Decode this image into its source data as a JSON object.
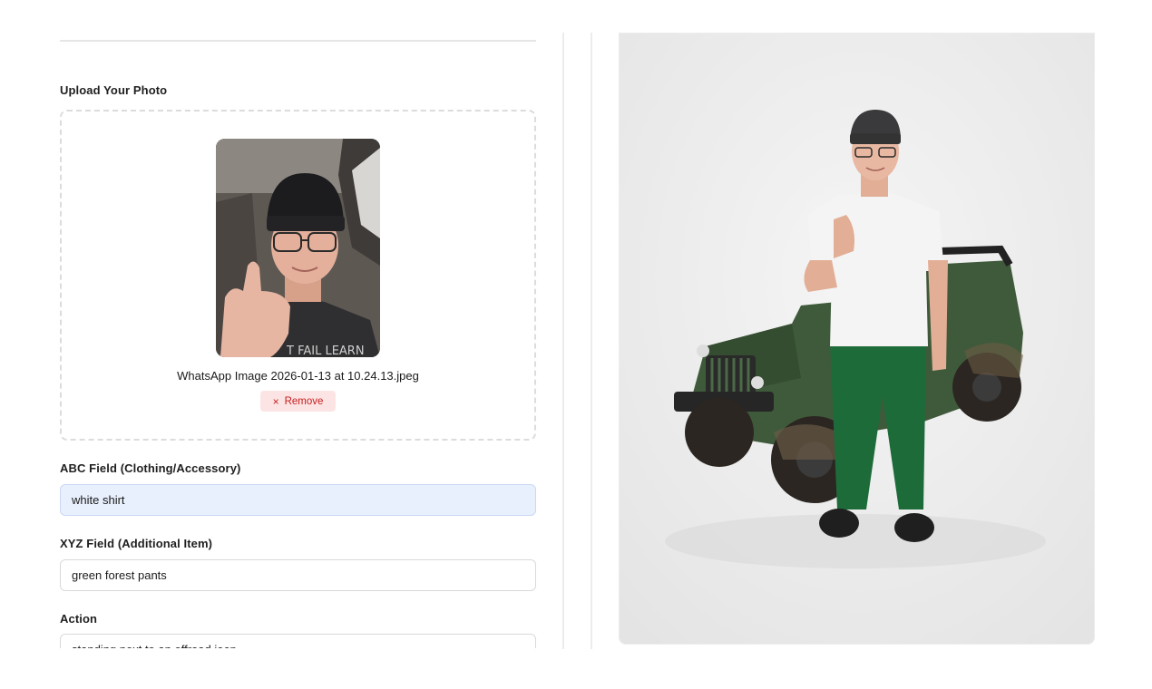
{
  "form": {
    "upload_label": "Upload Your Photo",
    "file_name": "WhatsApp Image 2026-01-13 at 10.24.13.jpeg",
    "remove_label": "Remove",
    "remove_icon": "×",
    "fields": [
      {
        "label": "ABC Field (Clothing/Accessory)",
        "value": "white shirt"
      },
      {
        "label": "XYZ Field (Additional Item)",
        "value": "green forest pants"
      },
      {
        "label": "Action",
        "value": "standing next to an offroad jeep"
      }
    ]
  },
  "colors": {
    "accent_input_bg": "#e8f0fd",
    "remove_bg": "#fde4e4",
    "remove_text": "#c41e1e",
    "divider": "#ececec"
  },
  "icons": {
    "remove": "close-icon"
  }
}
